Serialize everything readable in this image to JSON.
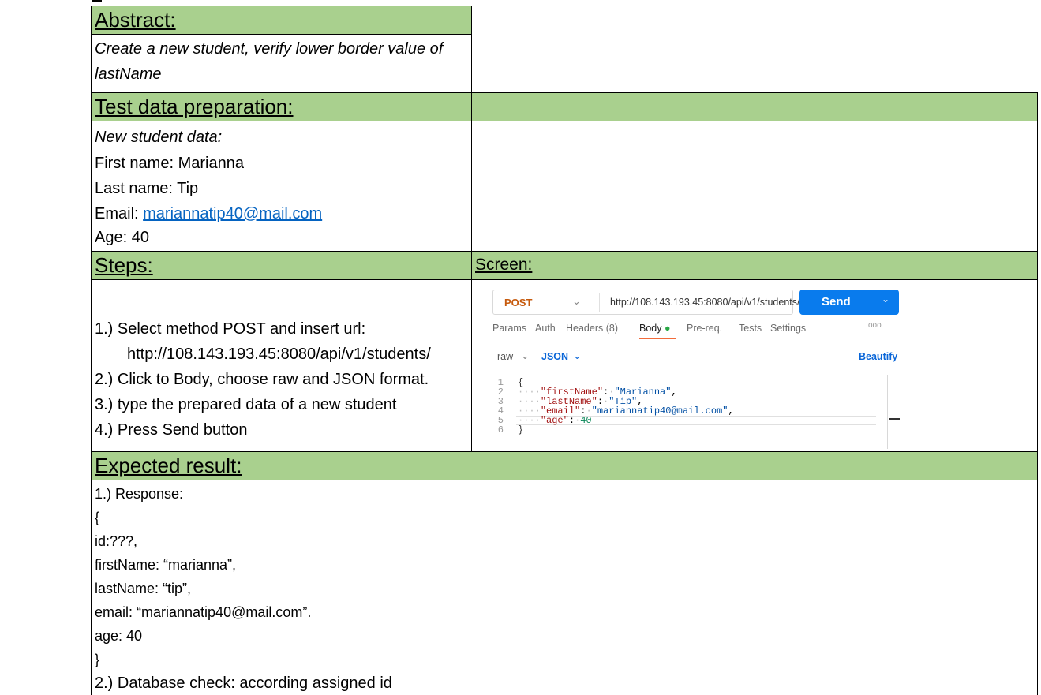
{
  "abstract": {
    "header": "Abstract:",
    "text_line1": "Create a new student, verify lower border value of",
    "text_line2": "lastName"
  },
  "test_data": {
    "header": "Test data preparation:",
    "intro": "New student data:",
    "first_name": "First name: Marianna",
    "last_name": "Last name: Tip",
    "email_label": "Email: ",
    "email_link": "mariannatip40@mail.com",
    "age": "Age: 40"
  },
  "steps": {
    "header": "Steps:",
    "screen_header": "Screen:",
    "items": [
      "1.) Select method POST and insert url:",
      "http://108.143.193.45:8080/api/v1/students/",
      "2.) Click to Body, choose raw and JSON format.",
      "3.) type the prepared data of a new student",
      "4.) Press Send button"
    ]
  },
  "screenshot": {
    "method": "POST",
    "url": "http://108.143.193.45:8080/api/v1/students/",
    "send_label": "Send",
    "tabs": [
      "Params",
      "Auth",
      "Headers (8)",
      "Body",
      "Pre-req.",
      "Tests",
      "Settings"
    ],
    "more_label": "ooo",
    "body_mode": "raw",
    "format": "JSON",
    "beautify_label": "Beautify",
    "line_numbers": [
      "1",
      "2",
      "3",
      "4",
      "5",
      "6"
    ],
    "code": {
      "open": "{",
      "close": "}",
      "first_key": "\"firstName\"",
      "first_val": "\"Marianna\"",
      "last_key": "\"lastName\"",
      "last_val": "\"Tip\"",
      "email_key": "\"email\"",
      "email_val": "\"mariannatip40@mail.com\"",
      "age_key": "\"age\"",
      "age_val": "40"
    },
    "colors": {
      "send": "#097bed",
      "method": "#c65a0d",
      "body_indicator": "#28a745"
    }
  },
  "expected": {
    "header": "Expected result:",
    "lines": [
      "1.) Response:",
      "{",
      "id:???,",
      "firstName: “marianna”,",
      "lastName: “tip”,",
      "email: “mariannatip40@mail.com”.",
      "age: 40",
      "}",
      "2.) Database check: according assigned id"
    ]
  },
  "colors": {
    "header_bg": "#a9d08e",
    "link": "#0563c1"
  }
}
